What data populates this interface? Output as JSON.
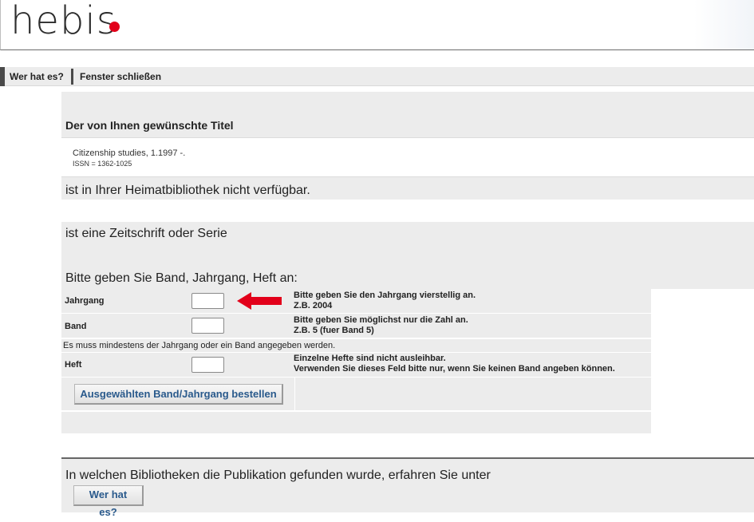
{
  "header": {
    "logo_text": "hebis",
    "logo_dot_color": "#e2001a"
  },
  "nav": {
    "items": [
      {
        "label": "Wer hat es?"
      },
      {
        "label": "Fenster schließen"
      }
    ]
  },
  "title_section": {
    "heading": "Der von Ihnen gewünschte Titel",
    "record_title": "Citizenship studies, 1.1997 -.",
    "record_issn": "ISSN = 1362-1025",
    "availability": "ist in Ihrer Heimatbibliothek nicht verfügbar."
  },
  "order_section": {
    "type_note": "ist eine Zeitschrift oder Serie",
    "instruction": "Bitte geben Sie Band, Jahrgang, Heft an:",
    "fields": [
      {
        "label": "Jahrgang",
        "value": "",
        "help_line1": "Bitte geben Sie den Jahrgang vierstellig an.",
        "help_line2": "Z.B. 2004"
      },
      {
        "label": "Band",
        "value": "",
        "help_line1": "Bitte geben Sie möglichst nur die Zahl an.",
        "help_line2": "Z.B. 5 (fuer Band 5)"
      },
      {
        "label": "Heft",
        "value": "",
        "help_line1": "Einzelne Hefte sind nicht ausleihbar.",
        "help_line2": "Verwenden Sie dieses Feld bitte nur, wenn Sie keinen Band angeben können."
      }
    ],
    "requirement_note": "Es muss mindestens der Jahrgang oder ein Band angegeben werden.",
    "submit_label": "Ausgewählten Band/Jahrgang bestellen",
    "arrow_color": "#e2001a"
  },
  "footer_section": {
    "text": "In welchen Bibliotheken die Publikation gefunden wurde, erfahren Sie unter",
    "button_label": "Wer hat es?"
  },
  "colors": {
    "panel_gray": "#ececec",
    "link_blue": "#2a5a8c"
  }
}
